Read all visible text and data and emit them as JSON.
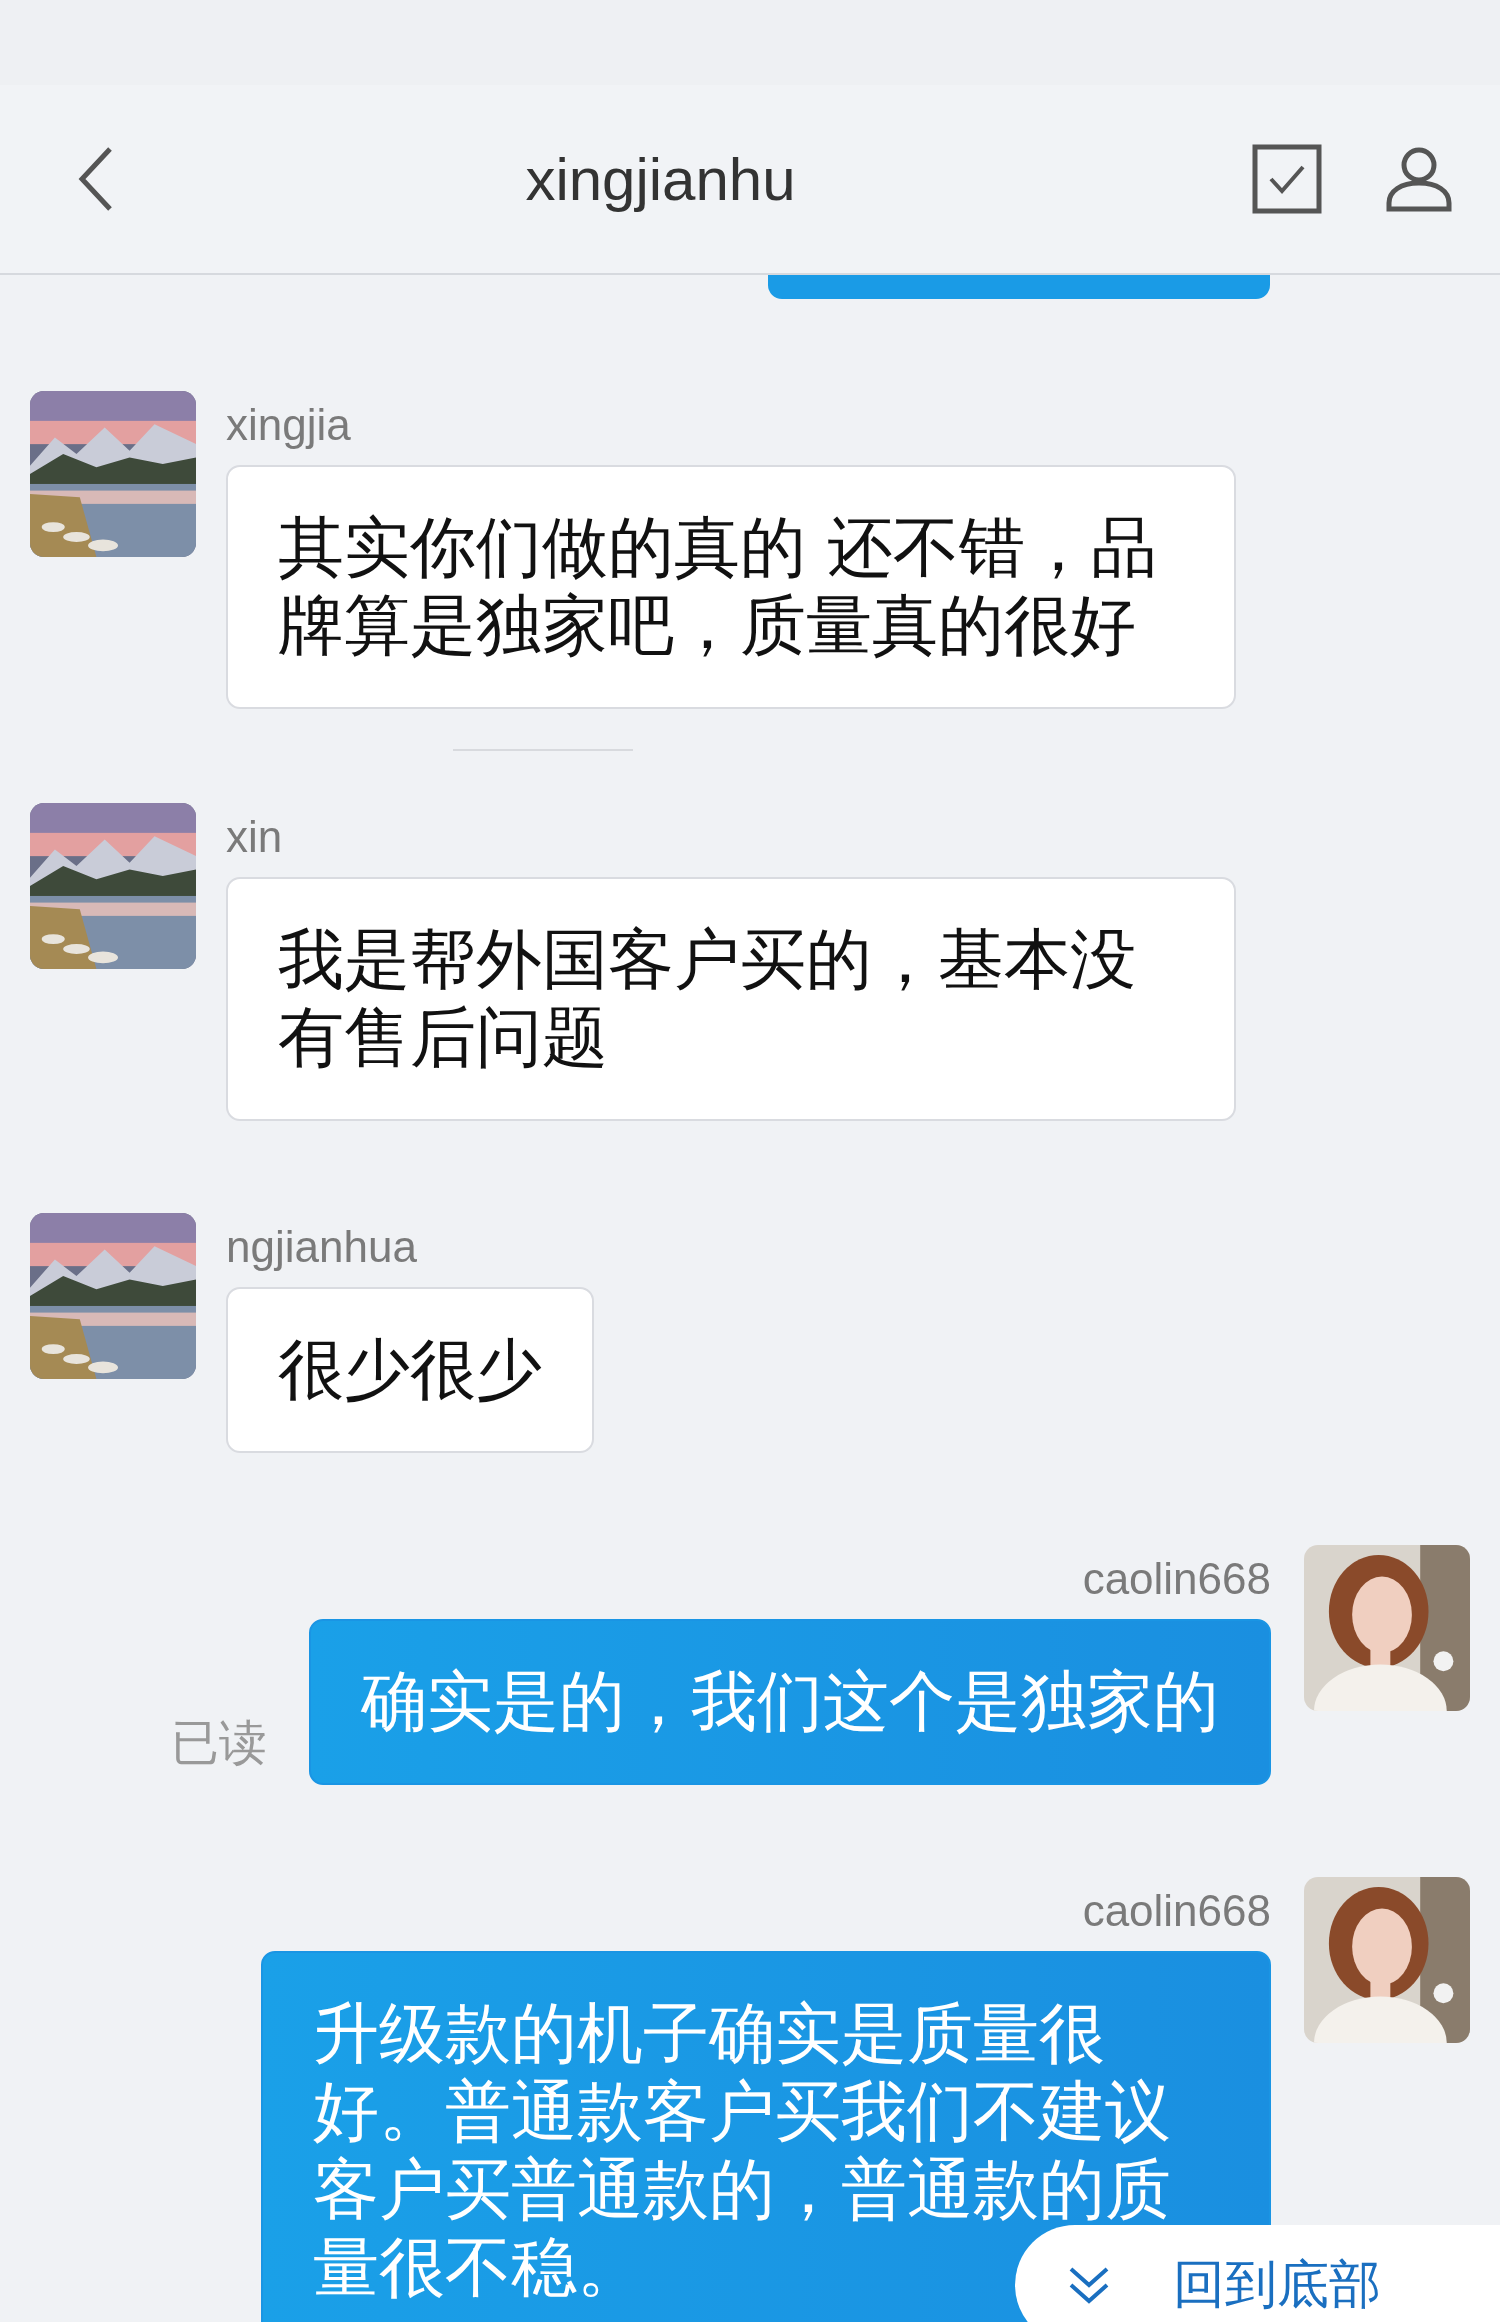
{
  "header": {
    "title": "xingjianhu"
  },
  "messages": [
    {
      "kind": "incoming",
      "sender": "xingjia",
      "text": "其实你们做的真的 还不错，品牌算是独家吧，质量真的很好"
    },
    {
      "kind": "separator"
    },
    {
      "kind": "incoming",
      "sender": "xin",
      "text": "我是帮外国客户买的，基本没有售后问题"
    },
    {
      "kind": "incoming",
      "sender": "ngjianhua",
      "text": "很少很少"
    },
    {
      "kind": "outgoing",
      "sender": "caolin668",
      "text": "确实是的，我们这个是独家的",
      "status": "已读"
    },
    {
      "kind": "outgoing",
      "sender": "caolin668",
      "text": "升级款的机子确实是质量很好。普通款客户买我们不建议客户买普通款的，普通款的质量很不稳。"
    }
  ],
  "jump_button": {
    "label": "回到底部"
  }
}
